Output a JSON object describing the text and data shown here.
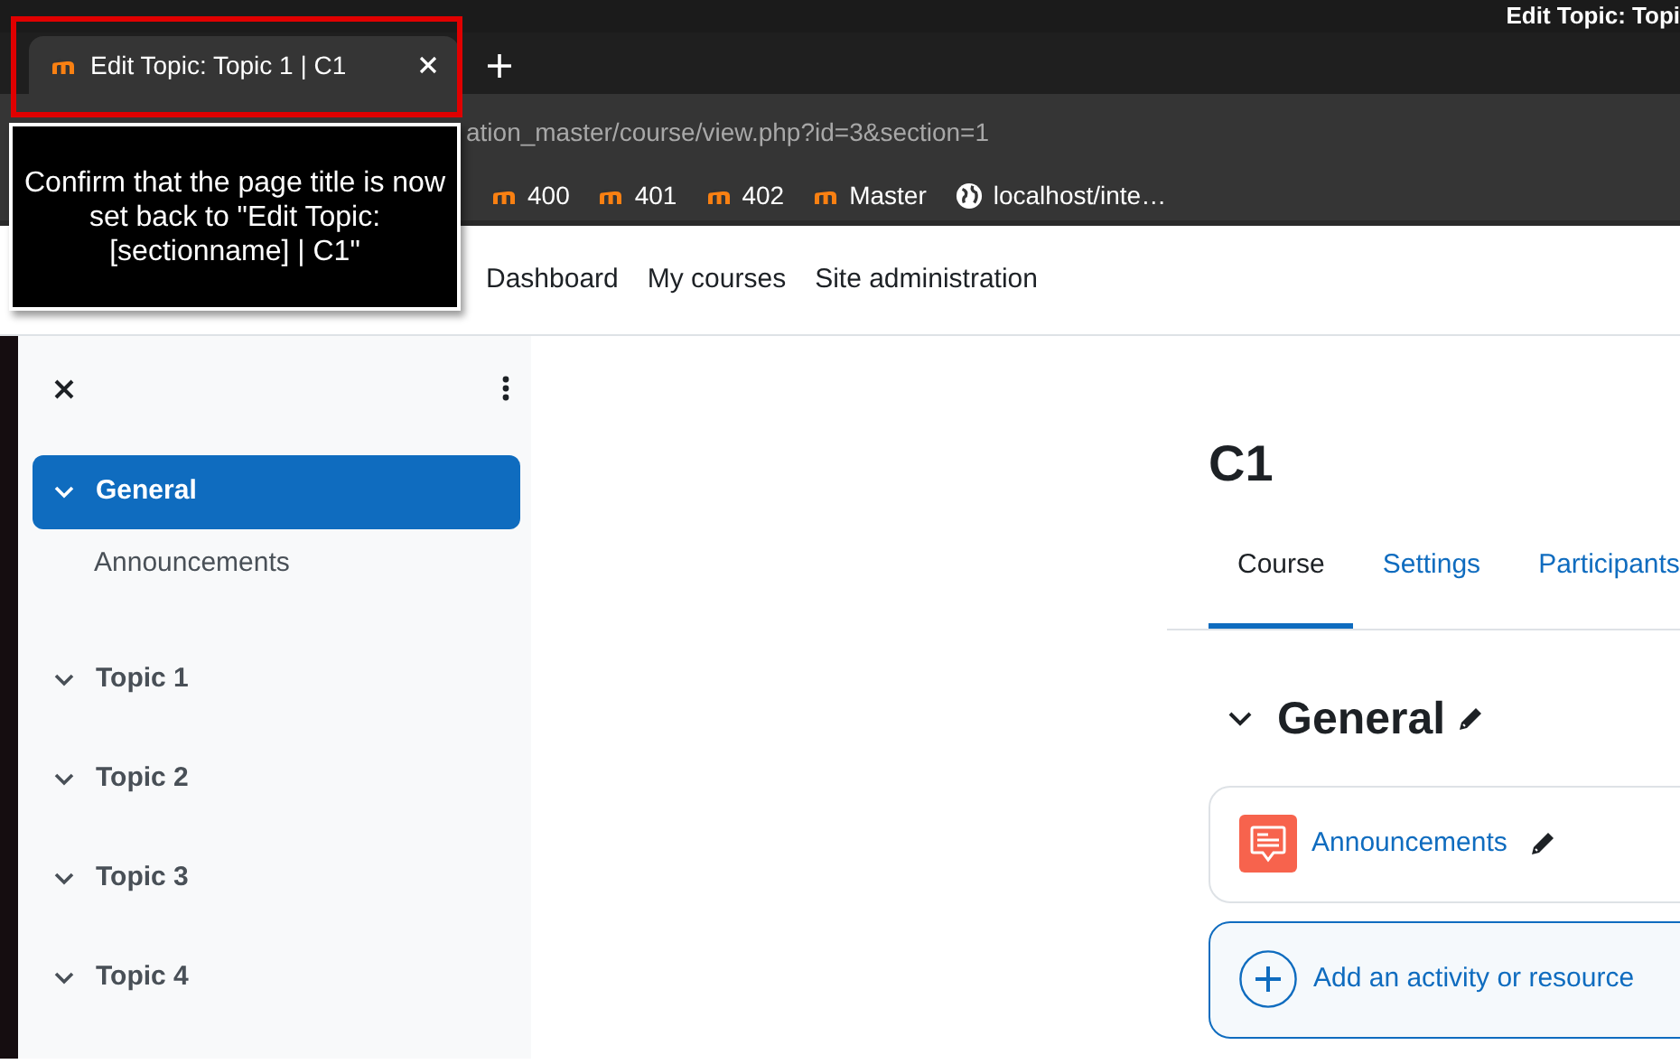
{
  "os_bar": {
    "title": "Edit Topic: Topi"
  },
  "tabs": [
    {
      "title": "Edit Topic: Topic 1 | C1",
      "selected": true
    }
  ],
  "address_bar": {
    "url": "ation_master/course/view.php?id=3&section=1"
  },
  "bookmarks": [
    {
      "label": "400",
      "kind": "moodle"
    },
    {
      "label": "401",
      "kind": "moodle"
    },
    {
      "label": "402",
      "kind": "moodle"
    },
    {
      "label": "Master",
      "kind": "moodle"
    },
    {
      "label": "localhost/inte…",
      "kind": "web"
    }
  ],
  "tooltip": {
    "text": "Confirm that the page title is now set back to \"Edit Topic: [sectionname] | C1\""
  },
  "nav": {
    "links": [
      "Dashboard",
      "My courses",
      "Site administration"
    ]
  },
  "course_index": {
    "sections": [
      {
        "title": "General",
        "selected": true,
        "children": [
          {
            "title": "Announcements"
          }
        ]
      },
      {
        "title": "Topic 1",
        "selected": false
      },
      {
        "title": "Topic 2",
        "selected": false
      },
      {
        "title": "Topic 3",
        "selected": false
      },
      {
        "title": "Topic 4",
        "selected": false
      }
    ]
  },
  "course": {
    "title": "C1",
    "tabs": [
      {
        "label": "Course",
        "selected": true
      },
      {
        "label": "Settings",
        "selected": false
      },
      {
        "label": "Participants",
        "selected": false
      }
    ],
    "section": {
      "title": "General",
      "activities": [
        {
          "name": "Announcements"
        }
      ],
      "add_label": "Add an activity or resource"
    }
  }
}
